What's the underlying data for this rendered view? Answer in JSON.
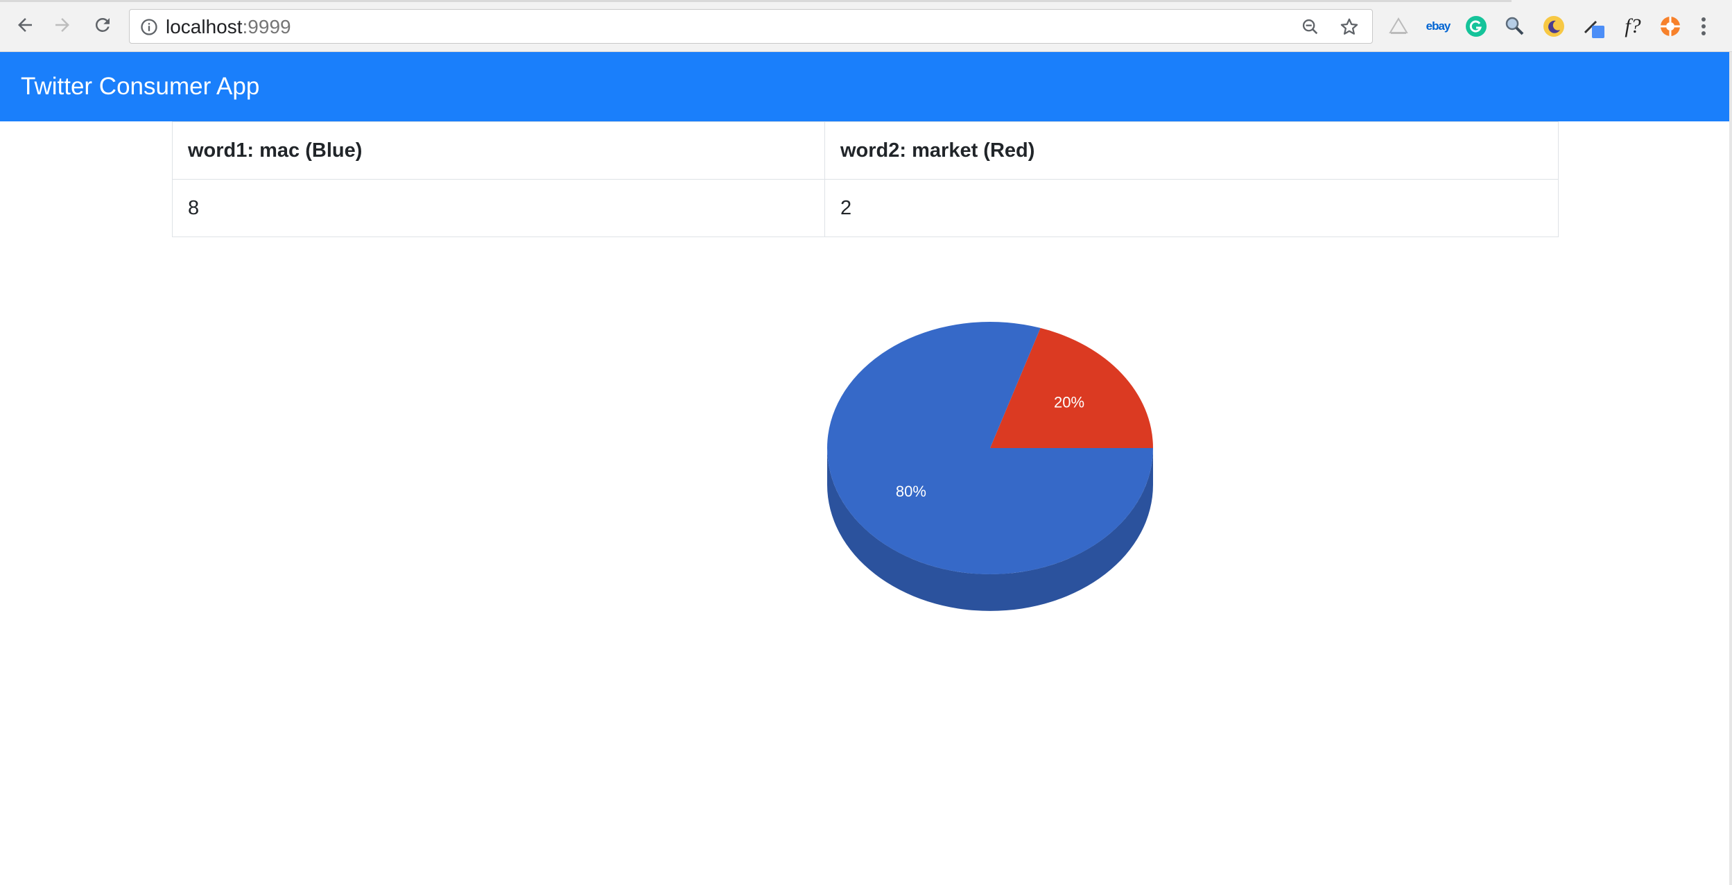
{
  "browser": {
    "url_host": "localhost",
    "url_port": ":9999",
    "extensions": [
      "drive-icon",
      "ebay-icon",
      "grammarly-icon",
      "magnifier-extension-icon",
      "dark-mode-icon",
      "eyedropper-icon",
      "fonts-icon",
      "lifebuoy-icon"
    ],
    "ebay_label": "ebay",
    "fonts_label": "f?"
  },
  "app": {
    "title": "Twitter Consumer App"
  },
  "table": {
    "headers": [
      "word1: mac (Blue)",
      "word2: market (Red)"
    ],
    "row": [
      "8",
      "2"
    ]
  },
  "chart_data": {
    "type": "pie",
    "categories": [
      "mac",
      "market"
    ],
    "values": [
      8,
      2
    ],
    "labels": [
      "80%",
      "20%"
    ],
    "colors": [
      "#3669c8",
      "#db3a22"
    ],
    "side_colors": [
      "#2b529d",
      "#a82d1a"
    ],
    "three_d": true,
    "title": "",
    "legend": "none"
  }
}
